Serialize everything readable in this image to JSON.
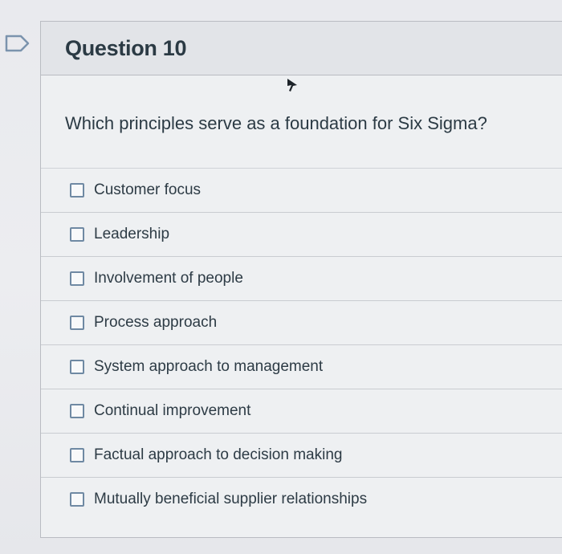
{
  "question": {
    "title": "Question 10",
    "prompt": "Which principles serve as a foundation for Six Sigma?"
  },
  "answers": [
    {
      "label": "Customer focus",
      "checked": false
    },
    {
      "label": "Leadership",
      "checked": false
    },
    {
      "label": "Involvement of people",
      "checked": false
    },
    {
      "label": "Process approach",
      "checked": false
    },
    {
      "label": "System approach to management",
      "checked": false
    },
    {
      "label": "Continual improvement",
      "checked": false
    },
    {
      "label": "Factual approach to decision making",
      "checked": false
    },
    {
      "label": "Mutually beneficial supplier relationships",
      "checked": false
    }
  ],
  "icons": {
    "flag": "flag-icon",
    "cursor": "mouse-pointer-icon",
    "checkbox": "checkbox-icon"
  },
  "colors": {
    "accent": "#6f89a3",
    "text": "#2d3b45",
    "border": "#b9bcc2"
  }
}
